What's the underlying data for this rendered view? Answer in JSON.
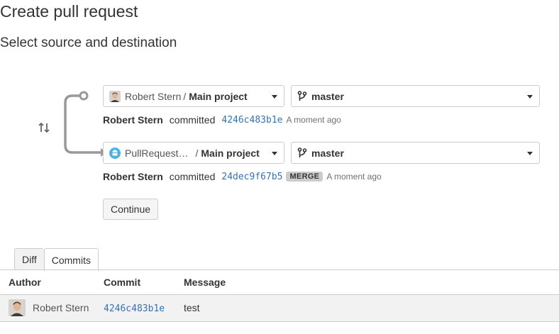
{
  "page": {
    "title": "Create pull request",
    "section_title": "Select source and destination"
  },
  "source": {
    "repo_owner": "Robert Stern",
    "repo_separator": "/",
    "repo_name": "Main project",
    "branch": "master",
    "commit": {
      "author": "Robert Stern",
      "verb": "committed",
      "hash": "4246c483b1e",
      "time": "A moment ago"
    }
  },
  "destination": {
    "repo_owner": "PullRequest…",
    "repo_separator": "/",
    "repo_name": "Main project",
    "branch": "master",
    "commit": {
      "author": "Robert Stern",
      "verb": "committed",
      "hash": "24dec9f67b5",
      "badge": "MERGE",
      "time": "A moment ago"
    }
  },
  "actions": {
    "continue_label": "Continue"
  },
  "tabs": [
    {
      "label": "Diff",
      "active": false
    },
    {
      "label": "Commits",
      "active": true
    }
  ],
  "commits_table": {
    "headers": {
      "author": "Author",
      "commit": "Commit",
      "message": "Message"
    },
    "rows": [
      {
        "author": "Robert Stern",
        "commit": "4246c483b1e",
        "message": "test"
      }
    ]
  },
  "colors": {
    "link": "#3572b0",
    "badge_bg": "#cccccc",
    "row_bg": "#f2f2f2",
    "border": "#cccccc"
  },
  "icons": {
    "swap": "swap-arrows-icon",
    "branch": "branch-icon",
    "dropdown": "chevron-down-icon"
  }
}
